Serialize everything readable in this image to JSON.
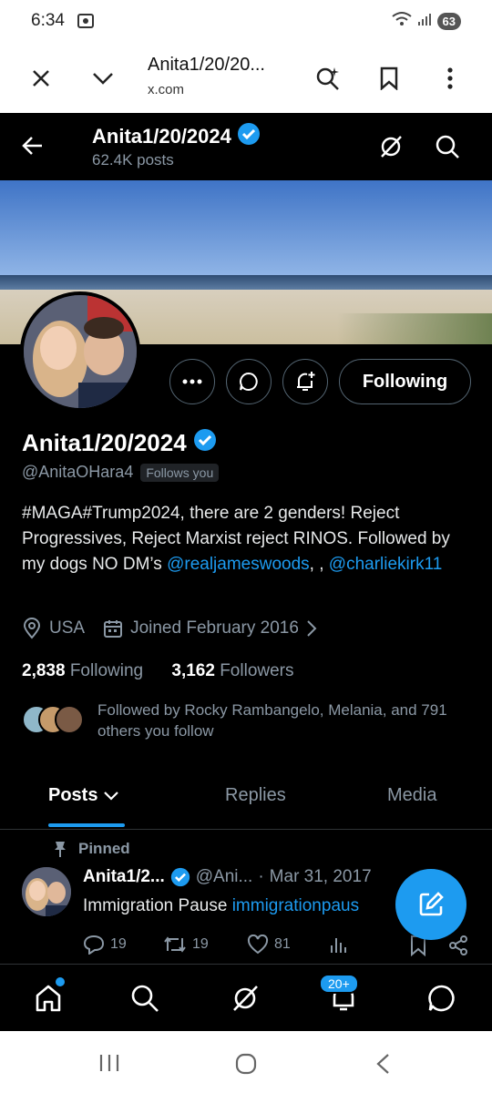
{
  "status_bar": {
    "time": "6:34",
    "battery": "63"
  },
  "browser": {
    "title": "Anita1/20/20...",
    "domain": "x.com"
  },
  "topbar": {
    "name": "Anita1/20/2024",
    "posts": "62.4K posts"
  },
  "profile": {
    "display_name": "Anita1/20/2024",
    "handle": "@AnitaOHara4",
    "follows_you": "Follows you",
    "following_label": "Following",
    "bio_text": "#MAGA#Trump2024, there are 2 genders! Reject Progressives, Reject Marxist reject RINOS. Followed by my dogs NO DM’s ",
    "bio_mention1": "@realjameswoods",
    "bio_sep": ", , ",
    "bio_mention2": "@charliekirk11",
    "location": "USA",
    "joined": "Joined February 2016",
    "following_count": "2,838",
    "following_word": "Following",
    "followers_count": "3,162",
    "followers_word": "Followers",
    "followed_by": "Followed by Rocky Rambangelo, Melania, and 791 others you follow"
  },
  "tabs": {
    "posts": "Posts",
    "replies": "Replies",
    "media": "Media"
  },
  "post": {
    "pinned": "Pinned",
    "name": "Anita1/2...",
    "handle": "@Ani...",
    "dot": "·",
    "date": "Mar 31, 2017",
    "text": "Immigration Pause ",
    "link": "immigrationpaus",
    "replies": "19",
    "reposts": "19",
    "likes": "81"
  },
  "bottom_nav": {
    "notif_badge": "20+"
  },
  "colors": {
    "accent": "#1d9bf0",
    "background": "#000000",
    "muted": "#8b98a5"
  }
}
